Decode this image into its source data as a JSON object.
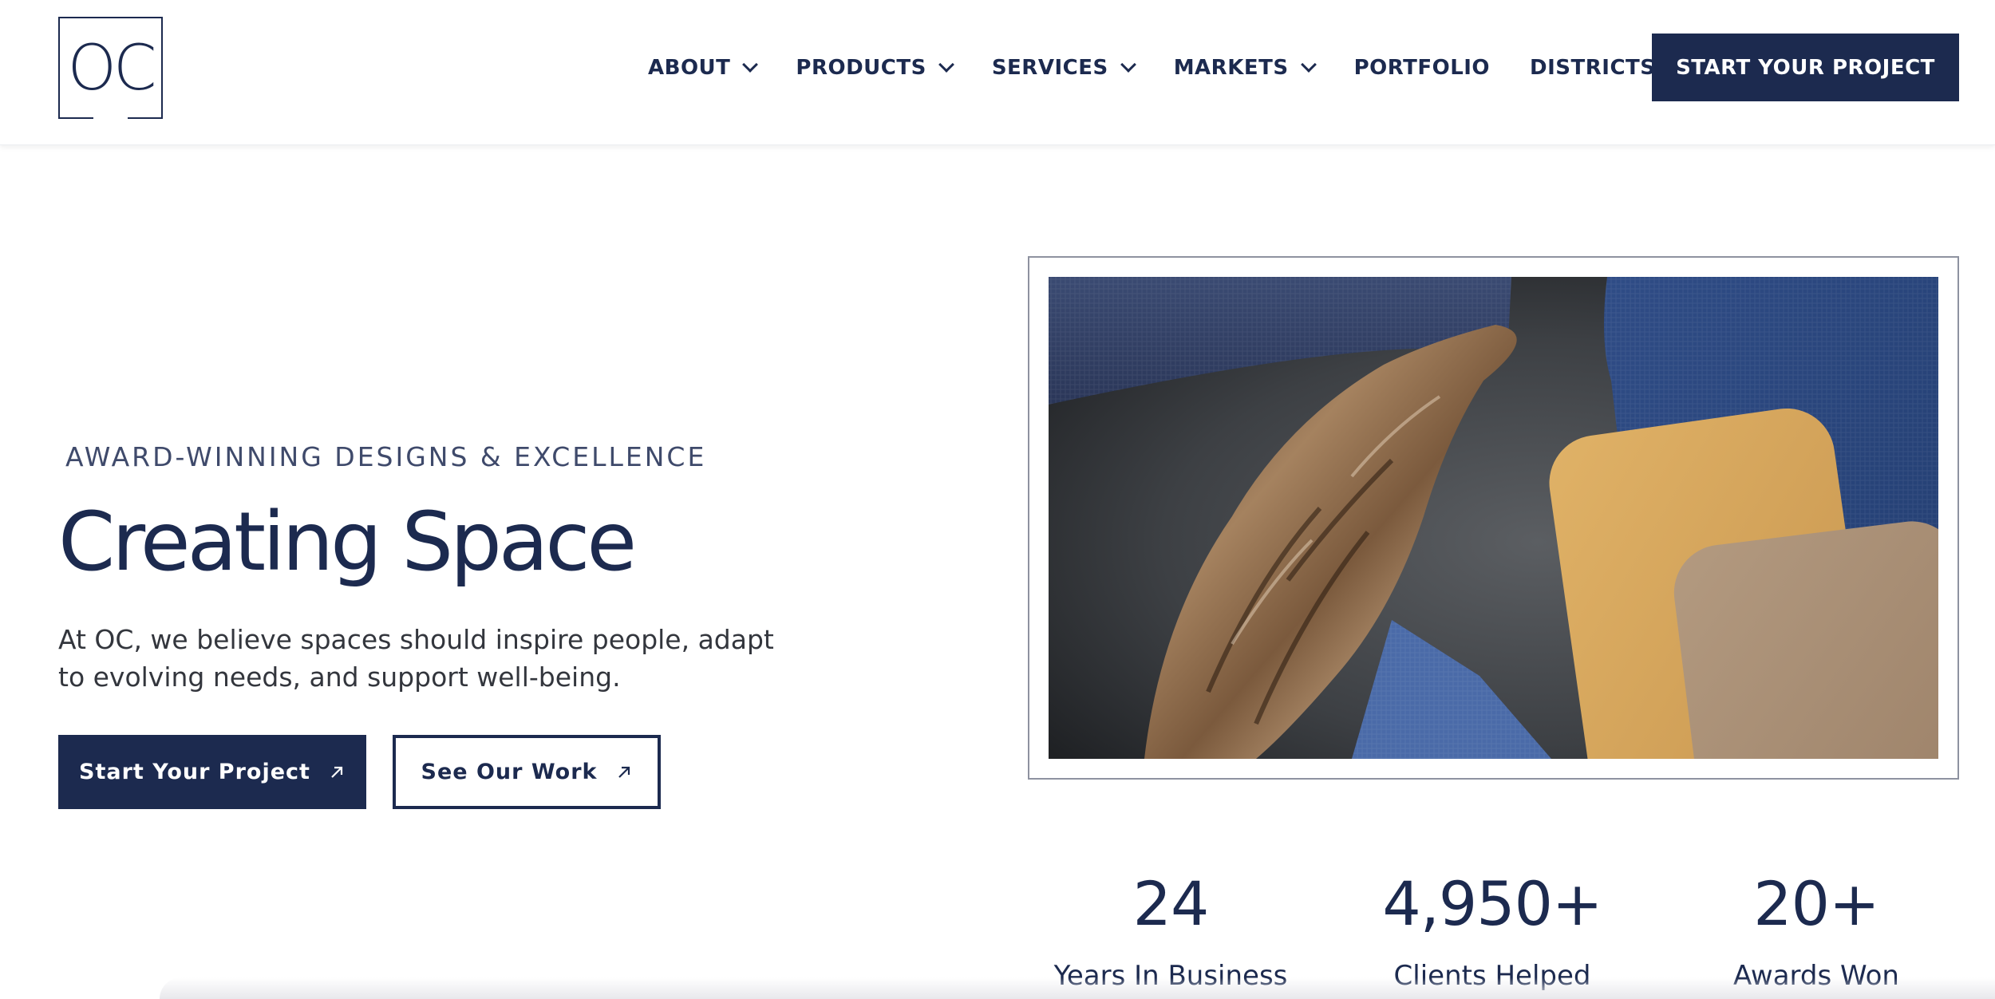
{
  "brand": {
    "logo_text": "OC"
  },
  "nav": {
    "items": [
      {
        "label": "ABOUT",
        "has_dropdown": true
      },
      {
        "label": "PRODUCTS",
        "has_dropdown": true
      },
      {
        "label": "SERVICES",
        "has_dropdown": true
      },
      {
        "label": "MARKETS",
        "has_dropdown": true
      },
      {
        "label": "PORTFOLIO",
        "has_dropdown": false
      },
      {
        "label": "DISTRICTS",
        "has_dropdown": true
      }
    ],
    "cta_label": "START YOUR PROJECT"
  },
  "hero": {
    "eyebrow": "AWARD-WINNING DESIGNS & EXCELLENCE",
    "title": "Creating Space",
    "text": "At OC, we believe spaces should inspire people, adapt to evolving needs, and support well-being.",
    "primary_button": "Start Your Project",
    "secondary_button": "See Our Work",
    "button_icon": "arrow-up-right-icon"
  },
  "stats": [
    {
      "value": "24",
      "label": "Years In Business"
    },
    {
      "value": "4,950+",
      "label": "Clients Helped"
    },
    {
      "value": "20+",
      "label": "Awards Won"
    }
  ],
  "colors": {
    "brand_navy": "#1c2a4f",
    "text_gray": "#33363d",
    "frame_gray": "#8e92a0"
  }
}
